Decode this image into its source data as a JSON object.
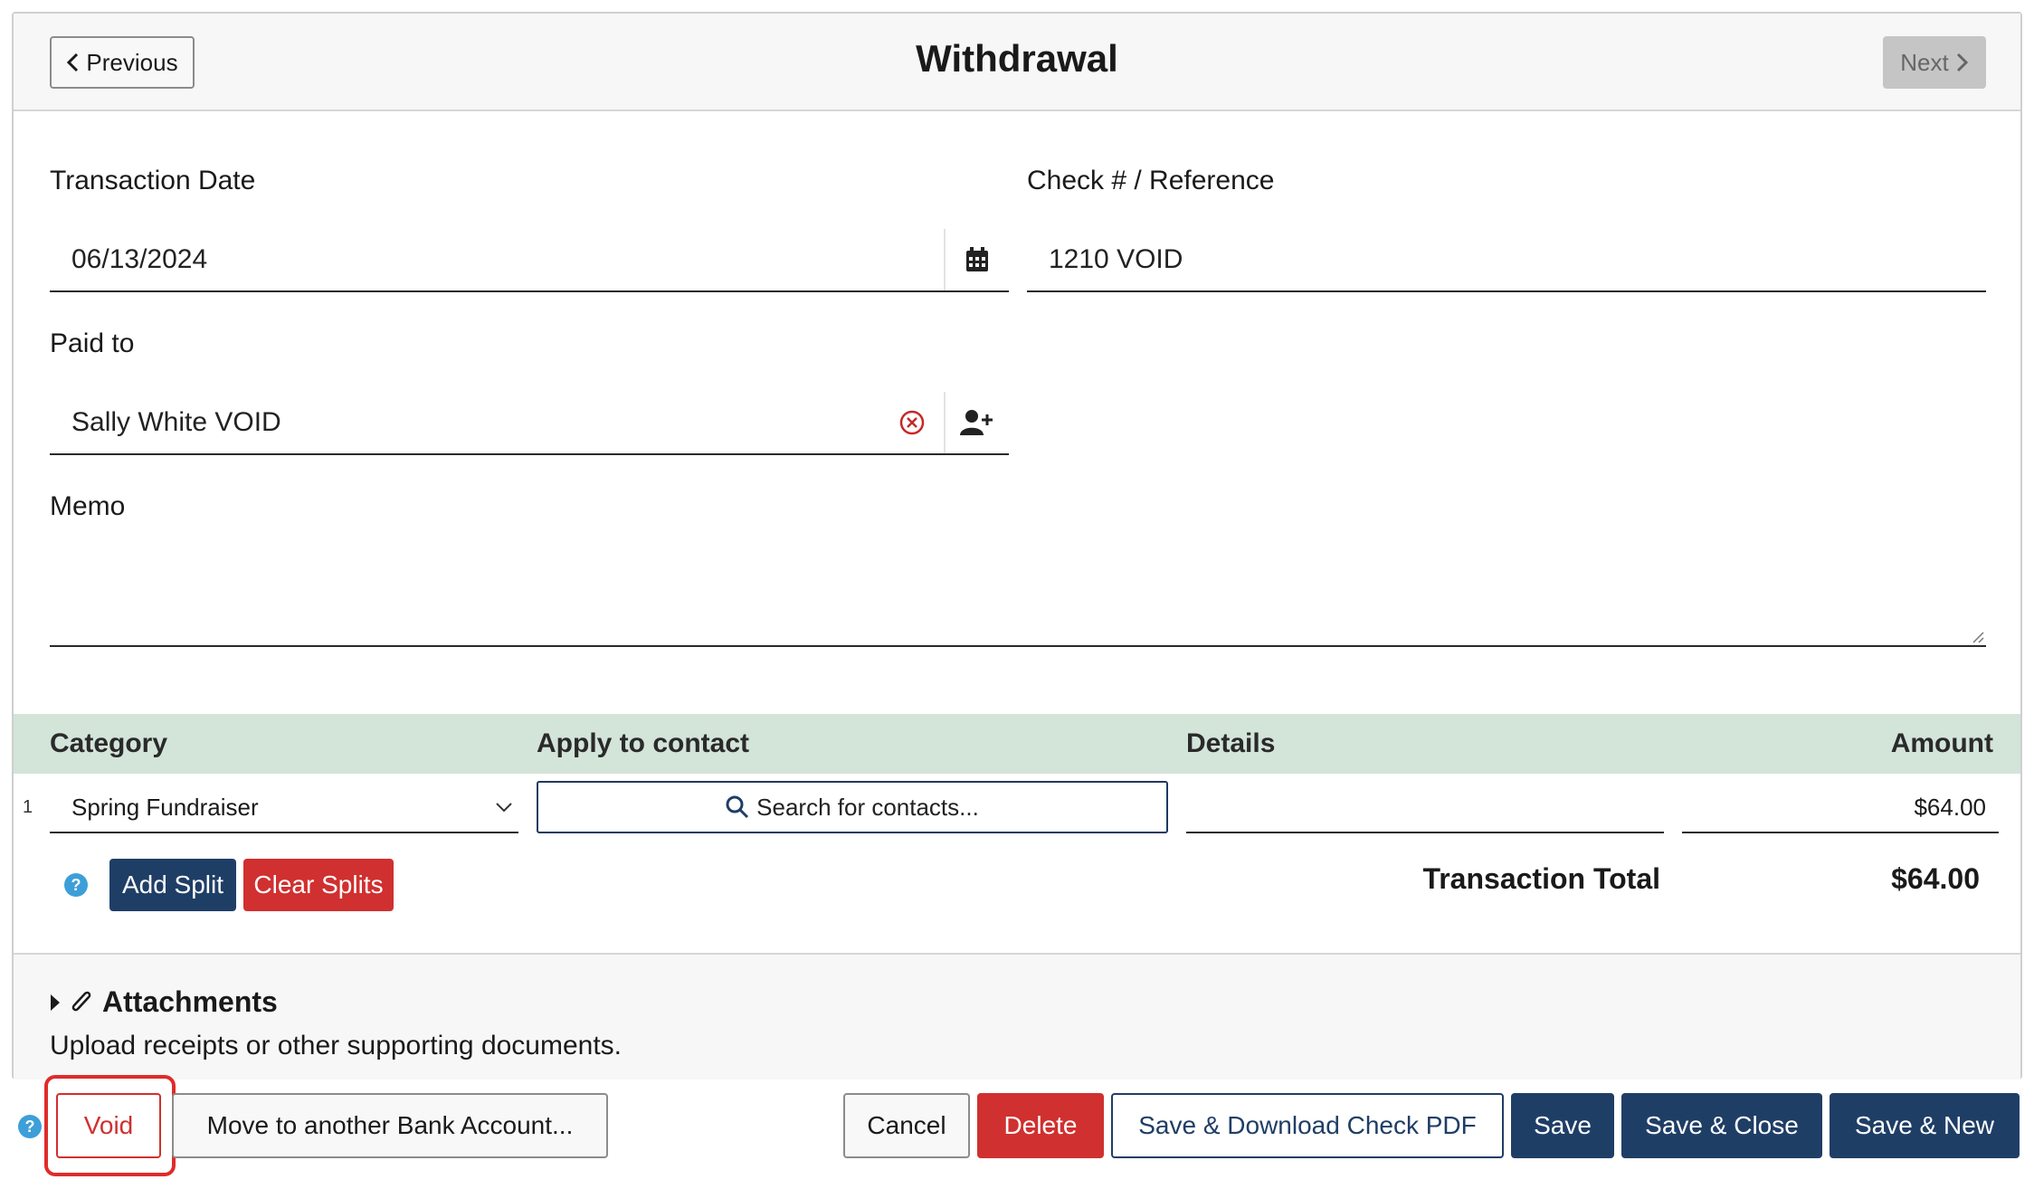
{
  "header": {
    "title": "Withdrawal",
    "previous_label": "Previous",
    "next_label": "Next"
  },
  "form": {
    "transaction_date_label": "Transaction Date",
    "transaction_date_value": "06/13/2024",
    "check_ref_label": "Check # / Reference",
    "check_ref_value": "1210 VOID",
    "paid_to_label": "Paid to",
    "paid_to_value": "Sally White VOID",
    "memo_label": "Memo",
    "memo_value": ""
  },
  "splits": {
    "headers": {
      "category": "Category",
      "apply_to_contact": "Apply to contact",
      "details": "Details",
      "amount": "Amount"
    },
    "rows": [
      {
        "num": "1",
        "category": "Spring Fundraiser",
        "contact_placeholder": "Search for contacts...",
        "details": "",
        "amount": "$64.00"
      }
    ],
    "add_split_label": "Add Split",
    "clear_splits_label": "Clear Splits",
    "total_label": "Transaction Total",
    "total_value": "$64.00"
  },
  "attachments": {
    "title": "Attachments",
    "subtitle": "Upload receipts or other supporting documents."
  },
  "footer": {
    "void_label": "Void",
    "move_label": "Move to another Bank Account...",
    "cancel_label": "Cancel",
    "delete_label": "Delete",
    "save_download_label": "Save & Download Check PDF",
    "save_label": "Save",
    "save_close_label": "Save & Close",
    "save_new_label": "Save & New"
  },
  "colors": {
    "navy": "#1f3e66",
    "red": "#d0302f",
    "table_header_bg": "#d3e4d9",
    "highlight": "#e02b2b"
  }
}
